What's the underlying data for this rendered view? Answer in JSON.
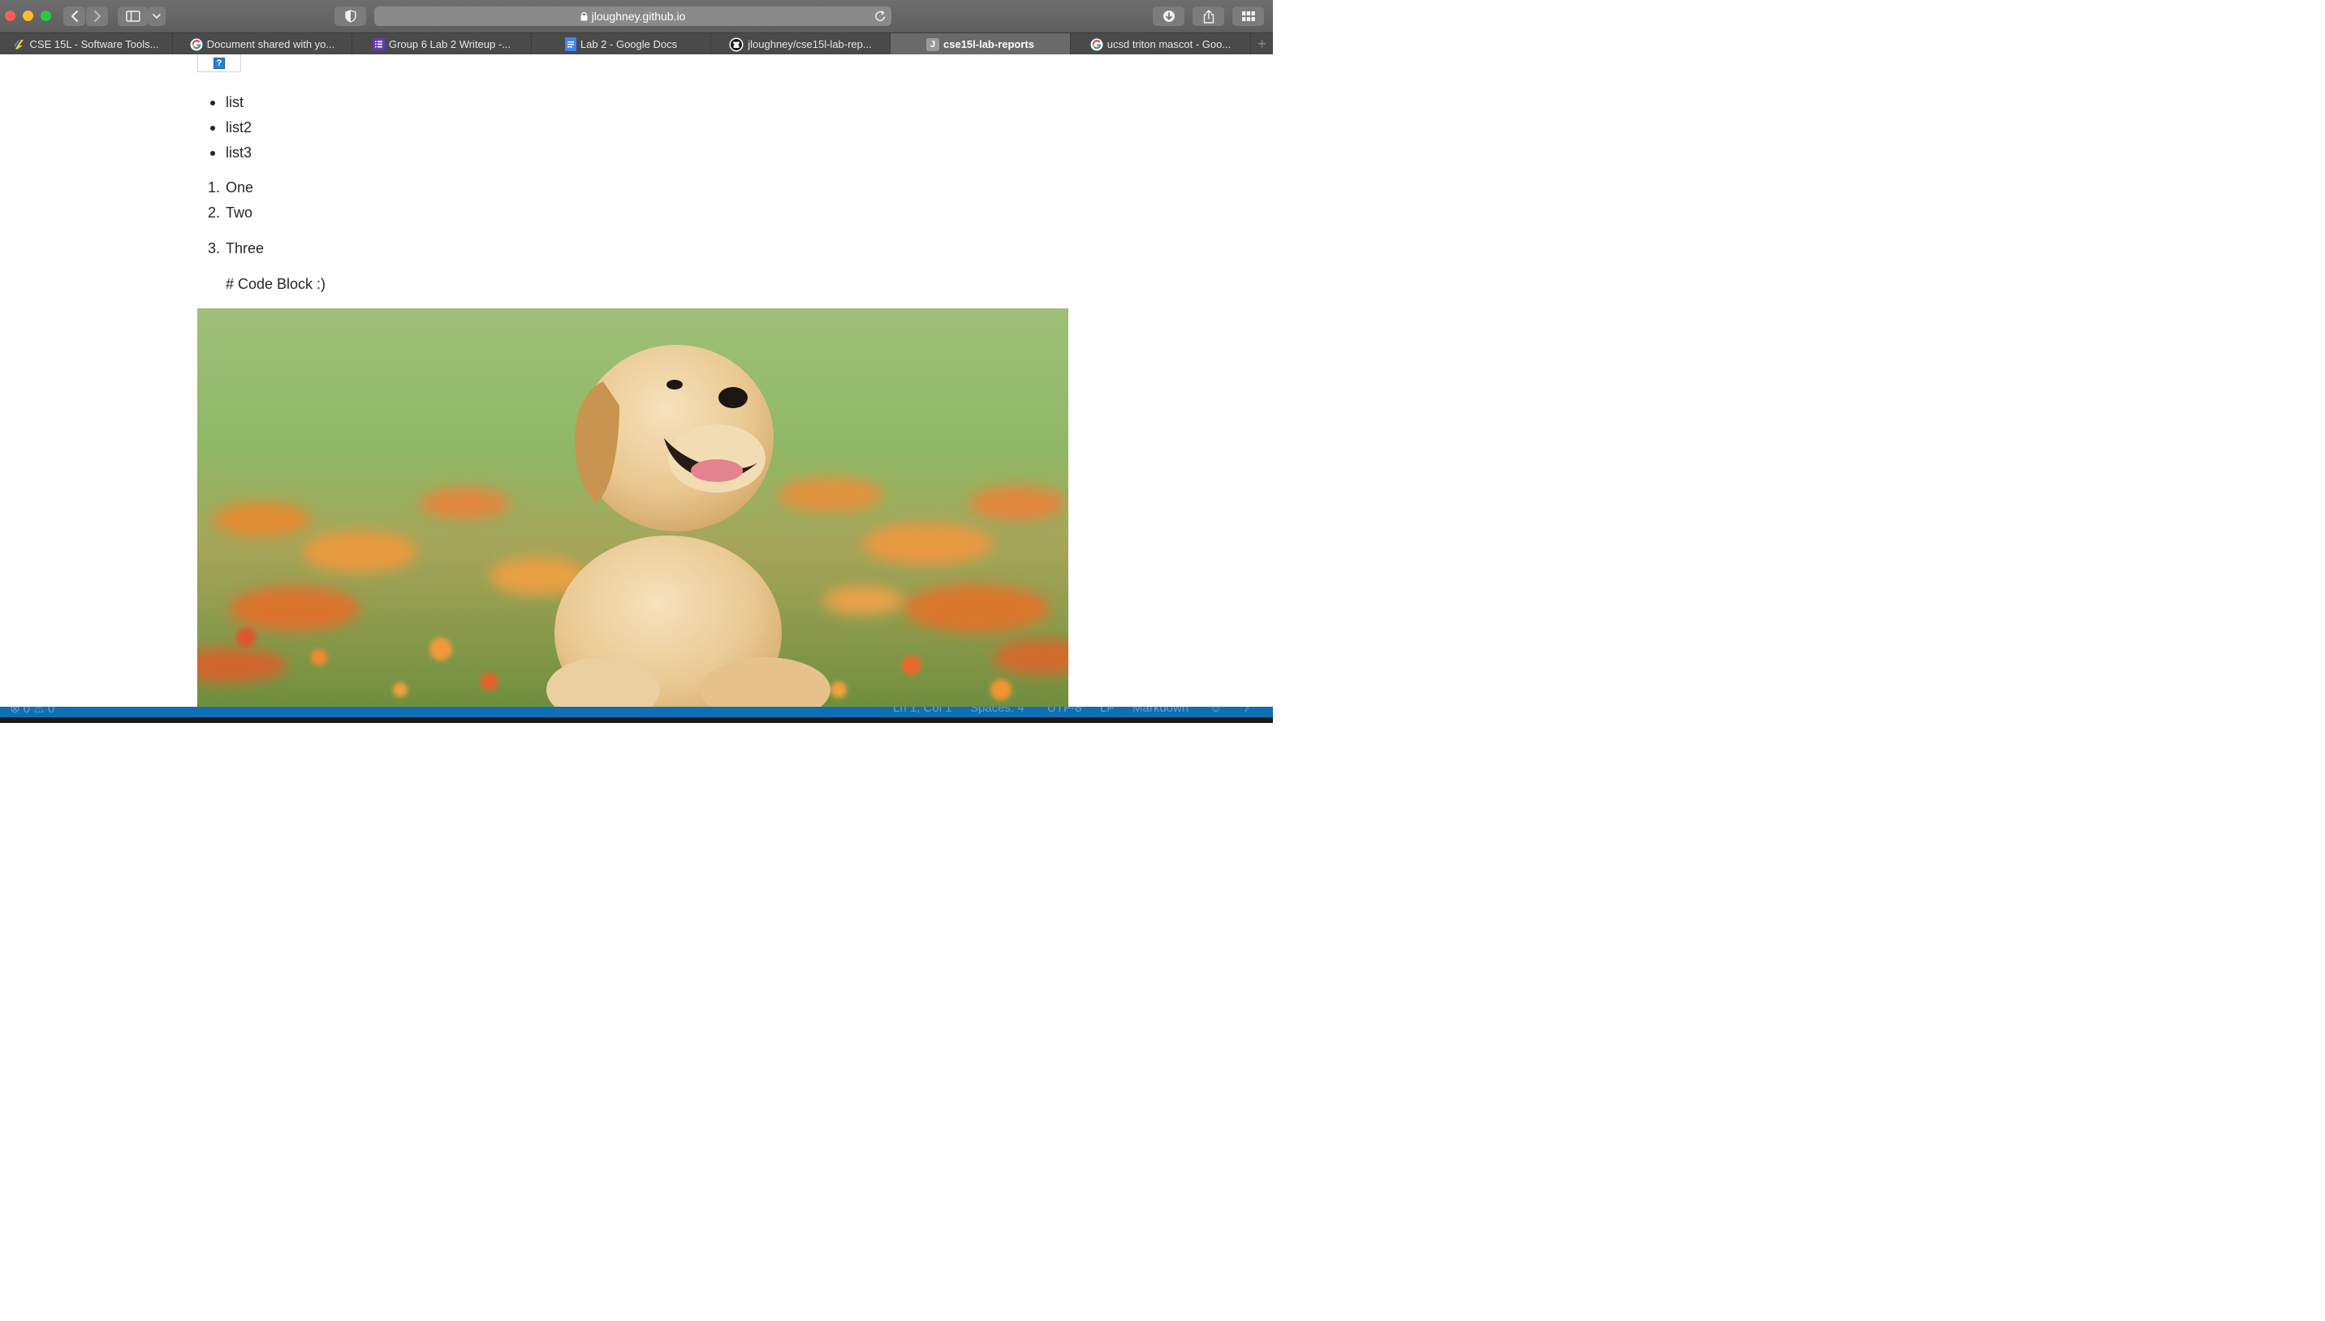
{
  "window": {
    "url": "jloughney.github.io"
  },
  "tabs": [
    {
      "label": "CSE 15L - Software Tools...",
      "icon": "lightning-icon",
      "active": false
    },
    {
      "label": "Document shared with yo...",
      "icon": "google-g-icon",
      "active": false
    },
    {
      "label": "Group 6 Lab 2 Writeup -...",
      "icon": "list-doc-icon",
      "active": false
    },
    {
      "label": "Lab 2 - Google Docs",
      "icon": "google-docs-icon",
      "active": false
    },
    {
      "label": "jloughney/cse15l-lab-rep...",
      "icon": "github-icon",
      "active": false
    },
    {
      "label": "cse15l-lab-reports",
      "icon": "j-letter-icon",
      "icon_letter": "J",
      "active": true
    },
    {
      "label": "ucsd triton mascot - Goo...",
      "icon": "google-g-icon",
      "active": false
    }
  ],
  "content": {
    "broken_image_glyph": "?",
    "bullet_list": [
      "list",
      "list2",
      "list3"
    ],
    "numbered_list": [
      {
        "number": "1.",
        "text": "One"
      },
      {
        "number": "2.",
        "text": "Two"
      },
      {
        "number": "3.",
        "text": "Three"
      }
    ],
    "code_line": "# Code Block :)"
  },
  "statusbar": {
    "left": "⊗ 0 ⚠ 0",
    "position": "Ln 1, Col 1",
    "spaces": "Spaces: 4",
    "encoding": "UTF-8",
    "eol": "LF",
    "language": "Markdown"
  },
  "colors": {
    "toolbar": "#646464",
    "tab_active": "#6a6a6a",
    "statusbar": "#0e6fb5"
  }
}
